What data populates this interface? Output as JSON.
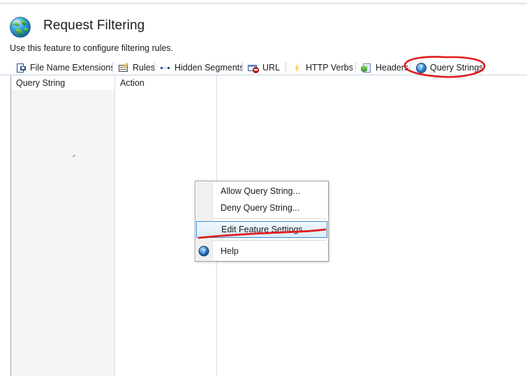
{
  "page": {
    "title": "Request Filtering",
    "description": "Use this feature to configure filtering rules.",
    "icon": "globe-icon"
  },
  "tabs": [
    {
      "label": "File Name Extensions",
      "icon": "file-extension-icon",
      "selected": false
    },
    {
      "label": "Rules",
      "icon": "rules-icon",
      "selected": false
    },
    {
      "label": "Hidden Segments",
      "icon": "hidden-segments-icon",
      "selected": false
    },
    {
      "label": "URL",
      "icon": "url-deny-icon",
      "selected": false
    },
    {
      "label": "HTTP Verbs",
      "icon": "lightning-bolt-icon",
      "selected": false
    },
    {
      "label": "Headers",
      "icon": "headers-document-icon",
      "selected": false
    },
    {
      "label": "Query Strings",
      "icon": "question-mark-icon",
      "selected": true
    }
  ],
  "listview": {
    "columns": [
      {
        "label": "Query String",
        "sorted": true,
        "sort_direction": "ascending"
      },
      {
        "label": "Action",
        "sorted": false
      },
      {
        "label": "",
        "sorted": false
      }
    ],
    "rows": []
  },
  "context_menu": {
    "items": [
      {
        "label": "Allow Query String...",
        "icon": "",
        "highlighted": false,
        "separator_after": false
      },
      {
        "label": "Deny Query String...",
        "icon": "",
        "highlighted": false,
        "separator_after": true
      },
      {
        "label": "Edit Feature Settings...",
        "icon": "",
        "highlighted": true,
        "separator_after": true
      },
      {
        "label": "Help",
        "icon": "question-mark-icon",
        "highlighted": false,
        "separator_after": false
      }
    ]
  },
  "annotations": {
    "color": "#e01b1b",
    "items": [
      {
        "shape": "ellipse",
        "target": "Query Strings tab"
      },
      {
        "shape": "underline",
        "target": "Edit Feature Settings..."
      }
    ]
  }
}
